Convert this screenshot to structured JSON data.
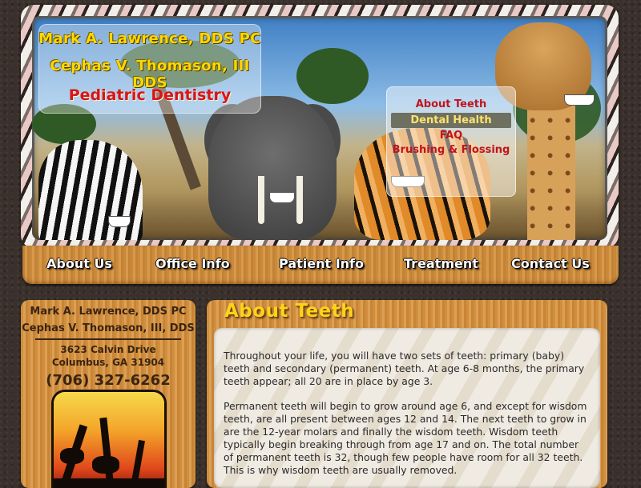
{
  "header": {
    "doctor_1": "Mark A. Lawrence, DDS PC",
    "doctor_2": "Cephas V. Thomason, III DDS",
    "specialty": "Pediatric Dentistry"
  },
  "banner_menu": {
    "items": [
      {
        "label": "About Teeth",
        "active": false
      },
      {
        "label": "Dental Health",
        "active": true
      },
      {
        "label": "FAQ",
        "active": false
      },
      {
        "label": "Brushing & Flossing",
        "active": false
      }
    ]
  },
  "nav": {
    "items": [
      "About Us",
      "Office Info",
      "Patient Info",
      "Treatment",
      "Contact Us"
    ]
  },
  "sidebar": {
    "name_1": "Mark A. Lawrence, DDS PC",
    "name_2": "Cephas V. Thomason, III, DDS",
    "address_1": "3623 Calvin Drive",
    "address_2": "Columbus, GA 31904",
    "phone": "(706) 327-6262"
  },
  "main": {
    "title": "About Teeth",
    "paragraphs": [
      "Throughout your life, you will have two sets of teeth: primary (baby) teeth and secondary (permanent) teeth. At age 6-8 months, the primary teeth appear; all 20 are in place by age 3.",
      "Permanent teeth will begin to grow around age 6, and except for wisdom teeth, are all present between ages 12 and 14. The next teeth to grow in are the 12-year molars and finally the wisdom teeth. Wisdom teeth typically begin breaking through from age 17 and on. The total number of permanent teeth is 32, though few people have room for all 32 teeth. This is why wisdom teeth are usually removed."
    ]
  },
  "colors": {
    "name_yellow": "#ffd800",
    "specialty_red": "#d8141c",
    "menu_red": "#c0141c",
    "active_bg": "#6e7062",
    "wood": "#cf8f3e"
  }
}
